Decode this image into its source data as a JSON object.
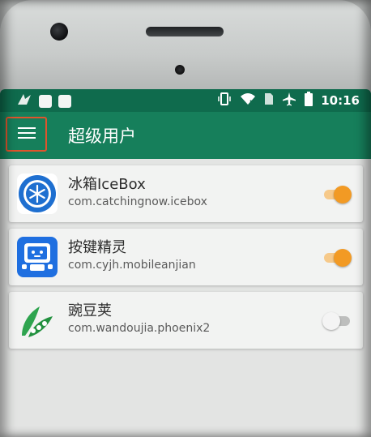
{
  "status_bar": {
    "time": "10:16",
    "icons": [
      "notification-bird-icon",
      "notification-square-icon",
      "notification-square-icon",
      "vibrate-icon",
      "wifi-icon",
      "sim-icon",
      "airplane-icon",
      "battery-icon"
    ]
  },
  "app_bar": {
    "title": "超级用户",
    "menu_icon": "hamburger-menu-icon",
    "highlight_color": "#e0542c"
  },
  "colors": {
    "status_bar": "#0f6b4d",
    "app_bar": "#167f5b",
    "toggle_on": "#f29a24",
    "toggle_off": "#f4f4f4"
  },
  "apps": [
    {
      "name": "冰箱IceBox",
      "package": "com.catchingnow.icebox",
      "icon": "icebox-snowflake-icon",
      "enabled": true
    },
    {
      "name": "按键精灵",
      "package": "com.cyjh.mobileanjian",
      "icon": "anjian-robot-icon",
      "enabled": true
    },
    {
      "name": "豌豆荚",
      "package": "com.wandoujia.phoenix2",
      "icon": "wandoujia-peapod-icon",
      "enabled": false
    }
  ]
}
